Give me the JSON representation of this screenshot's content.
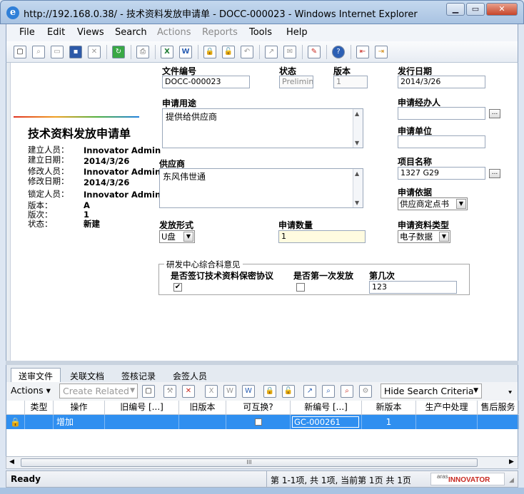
{
  "window": {
    "title": "http://192.168.0.38/ - 技术资料发放申请单 - DOCC-000023 - Windows Internet Explorer",
    "icon": "ie-icon",
    "controls": {
      "minimize": "▁",
      "maximize": "▭",
      "close": "✕"
    }
  },
  "menu": [
    "File",
    "Edit",
    "Views",
    "Search",
    "Actions",
    "Reports",
    "Tools",
    "Help"
  ],
  "toolbar_icons": [
    "new-icon",
    "print-preview-icon",
    "open-icon",
    "save-icon",
    "delete-icon",
    "refresh-icon",
    "print-icon",
    "excel-icon",
    "word-icon",
    "lock-icon",
    "unlock-icon",
    "undo-icon",
    "promote-icon",
    "discuss-icon",
    "sign-icon",
    "help-icon",
    "exit-icon",
    "logout-icon"
  ],
  "item_info": {
    "form_title": "技术资料发放申请单",
    "rows": [
      {
        "label": "建立人员：",
        "value": "Innovator Admin"
      },
      {
        "label": "建立日期：",
        "value": "2014/3/26"
      },
      {
        "label": "修改人员：",
        "value": "Innovator Admin"
      },
      {
        "label": "修改日期：",
        "value": "2014/3/26"
      },
      {
        "label": "锁定人员：",
        "value": "Innovator Admin"
      },
      {
        "label": "版本：",
        "value": "A"
      },
      {
        "label": "版次：",
        "value": "1"
      },
      {
        "label": "状态：",
        "value": "新建"
      }
    ]
  },
  "form": {
    "doc_no_label": "文件编号",
    "doc_no": "DOCC-000023",
    "status_label": "状态",
    "status": "Preliminary",
    "version_label": "版本",
    "version": "1",
    "issue_date_label": "发行日期",
    "issue_date": "2014/3/26",
    "purpose_label": "申请用途",
    "purpose": "提供给供应商",
    "handler_label": "申请经办人",
    "handler": "",
    "unit_label": "申请单位",
    "unit": "",
    "supplier_label": "供应商",
    "supplier": "东风伟世通",
    "project_label": "项目名称",
    "project": "1327 G29",
    "basis_label": "申请依据",
    "basis": "供应商定点书",
    "release_form_label": "发放形式",
    "release_form": "U盘",
    "quantity_label": "申请数量",
    "quantity": "1",
    "material_type_label": "申请资料类型",
    "material_type": "电子数据",
    "rd_group_label": "研发中心综合科意见",
    "nda_label": "是否签订技术资料保密协议",
    "nda_checked": "✔",
    "first_release_label": "是否第一次发放",
    "times_label": "第几次",
    "times": "123"
  },
  "tabs": [
    "送审文件",
    "关联文档",
    "签核记录",
    "会签人员"
  ],
  "grid_toolbar": {
    "actions": "Actions",
    "create_related": "Create Related",
    "hide_search": "Hide Search Criteria"
  },
  "grid": {
    "columns": [
      "类型",
      "操作",
      "旧编号 [...]",
      "旧版本",
      "可互换?",
      "新编号 [...]",
      "新版本",
      "生产中处理",
      "售后服务"
    ],
    "row": {
      "type": "",
      "action": "增加",
      "old_no": "",
      "old_ver": "",
      "interchangeable": "",
      "new_no": "GC-000261",
      "new_ver": "1",
      "production": "",
      "service": ""
    }
  },
  "hscroll_grip": "III",
  "status": {
    "ready": "Ready",
    "paging": "第 1-1项, 共 1项, 当前第 1页 共 1页",
    "logo_top": "aras",
    "logo": "INNOVATOR"
  }
}
